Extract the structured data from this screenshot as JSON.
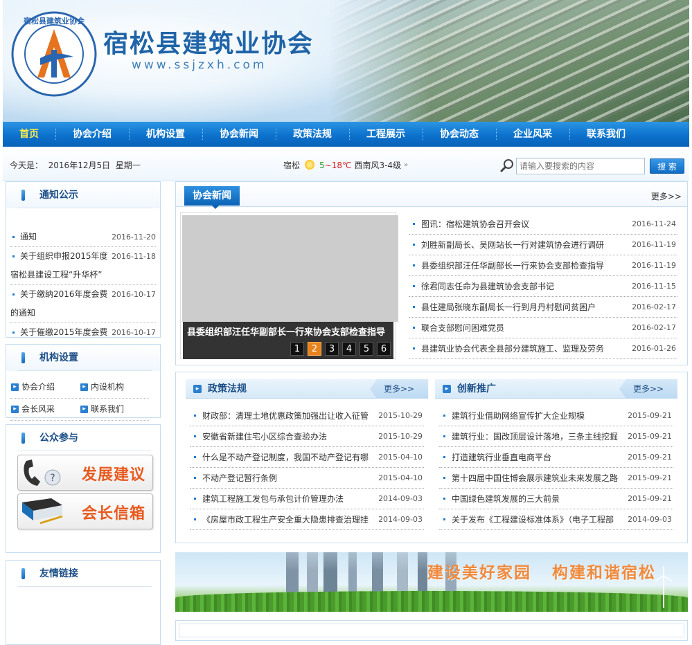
{
  "header": {
    "site_name": "宿松县建筑业协会",
    "site_url": "www.ssjzxh.com",
    "logo_text": "宿松县建筑业协会"
  },
  "nav": {
    "items": [
      "首页",
      "协会介绍",
      "机构设置",
      "协会新闻",
      "政策法规",
      "工程展示",
      "协会动态",
      "企业风采",
      "联系我们"
    ],
    "active_index": 0
  },
  "infobar": {
    "today_label": "今天是：",
    "date": "2016年12月5日",
    "weekday": "星期一",
    "city": "宿松",
    "temp_low": "5",
    "temp_high": "18℃",
    "temp_sep": "~",
    "wind": "西南风3-4级",
    "search_placeholder": "请输入要搜索的内容",
    "search_button": "搜 索"
  },
  "sidebar": {
    "notice": {
      "title": "通知公示",
      "items": [
        {
          "title": "通知",
          "date": "2016-11-20"
        },
        {
          "title": "关于组织申报2015年度宿松县建设工程“升华杯”",
          "date": "2016-11-18"
        },
        {
          "title": "关于缴纳2016年度会费的通知",
          "date": "2016-10-17"
        },
        {
          "title": "关于催缴2015年度会费",
          "date": "2016-10-17"
        }
      ]
    },
    "org": {
      "title": "机构设置",
      "items": [
        "协会介绍",
        "内设机构",
        "会长风采",
        "联系我们"
      ]
    },
    "public": {
      "title": "公众参与",
      "suggest": "发展建议",
      "mailbox": "会长信箱"
    },
    "links": {
      "title": "友情链接"
    }
  },
  "news": {
    "tab": "协会新闻",
    "more": "更多>>",
    "slide_caption": "县委组织部汪任华副部长一行来协会支部检查指导",
    "slide_pages": [
      "1",
      "2",
      "3",
      "4",
      "5",
      "6"
    ],
    "slide_active": 1,
    "items": [
      {
        "title": "图讯：宿松建筑协会召开会议",
        "date": "2016-11-24"
      },
      {
        "title": "刘胜新副局长、吴刚站长一行对建筑协会进行调研",
        "date": "2016-11-19"
      },
      {
        "title": "县委组织部汪任华副部长一行来协会支部检查指导",
        "date": "2016-11-19"
      },
      {
        "title": "徐君同志任命为县建筑协会支部书记",
        "date": "2016-11-15"
      },
      {
        "title": "县住建局张晓东副局长一行到月丹村慰问贫困户",
        "date": "2016-02-17"
      },
      {
        "title": "联合支部慰问困难党员",
        "date": "2016-02-17"
      },
      {
        "title": "县建筑业协会代表全县部分建筑施工、监理及劳务",
        "date": "2016-01-26"
      }
    ]
  },
  "policy": {
    "title": "政策法规",
    "more": "更多>>",
    "items": [
      {
        "title": "财政部：清理土地优惠政策加强出让收入征管",
        "date": "2015-10-29"
      },
      {
        "title": "安徽省新建住宅小区综合查验办法",
        "date": "2015-10-29"
      },
      {
        "title": "什么是不动产登记制度，我国不动产登记有哪",
        "date": "2015-04-10"
      },
      {
        "title": "不动产登记暂行条例",
        "date": "2015-04-10"
      },
      {
        "title": "建筑工程施工发包与承包计价管理办法",
        "date": "2014-09-03"
      },
      {
        "title": "《房屋市政工程生产安全重大隐患排查治理挂",
        "date": "2014-09-03"
      }
    ]
  },
  "innovation": {
    "title": "创新推广",
    "more": "更多>>",
    "items": [
      {
        "title": "建筑行业借助网络宣传扩大企业规模",
        "date": "2015-09-21"
      },
      {
        "title": "建筑行业：国改顶层设计落地，三条主线挖掘",
        "date": "2015-09-21"
      },
      {
        "title": "打造建筑行业垂直电商平台",
        "date": "2015-09-21"
      },
      {
        "title": "第十四届中国住博会展示建筑业未来发展之路",
        "date": "2015-09-21"
      },
      {
        "title": "中国绿色建筑发展的三大前景",
        "date": "2015-09-21"
      },
      {
        "title": "关于发布《工程建设标准体系》（电子工程部",
        "date": "2014-09-03"
      }
    ]
  },
  "banner": {
    "slogan": "建设美好家园 构建和谐宿松"
  },
  "colors": {
    "nav_blue": "#0c72cc",
    "active_nav": "#ffe94a",
    "title_blue": "#1c4e86",
    "slogan_orange": "#f08a3c"
  }
}
